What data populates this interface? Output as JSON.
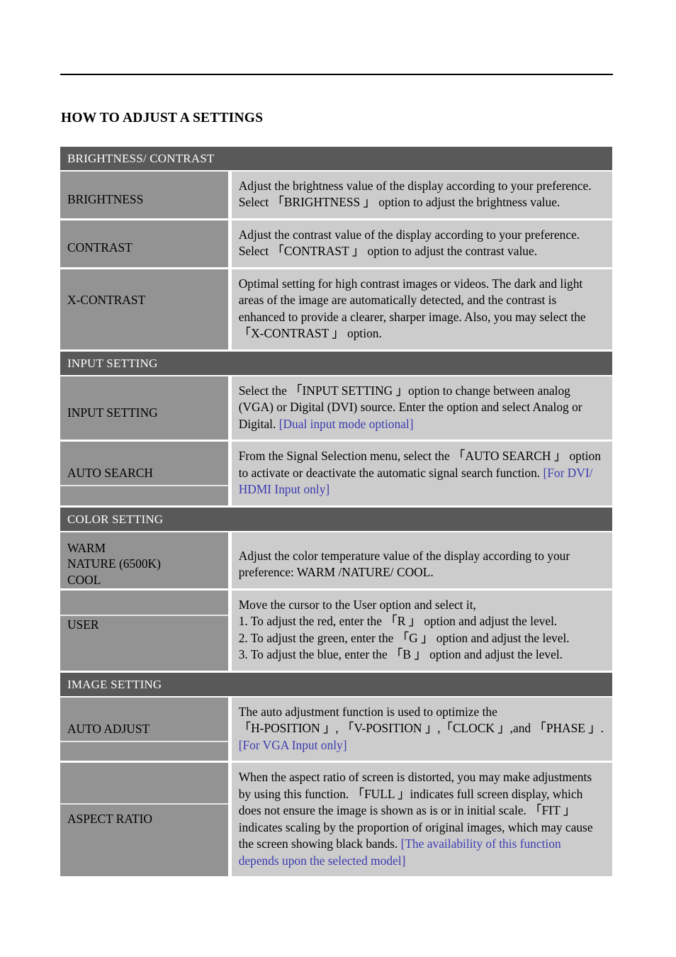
{
  "document": {
    "title": "HOW TO ADJUST A SETTINGS",
    "colors": {
      "section_band": "#595959",
      "label_cell": "#939393",
      "desc_cell": "#cccccc",
      "note_text": "#3b3bb0",
      "rule": "#000000"
    }
  },
  "sections": [
    {
      "header": "BRIGHTNESS/ CONTRAST",
      "rows": [
        {
          "label": "BRIGHTNESS",
          "desc": "Adjust the brightness value of the display according to your preference. Select 「BRIGHTNESS 」 option to adjust the brightness value."
        },
        {
          "label": "CONTRAST",
          "desc": "Adjust the contrast value of the display according to your preference. Select 「CONTRAST 」 option to adjust the contrast value."
        },
        {
          "label": "X-CONTRAST",
          "desc": "Optimal setting for high contrast images or videos. The dark and light areas of the image are automatically detected, and the contrast is enhanced to provide a clearer, sharper image. Also, you may select the 「X-CONTRAST 」 option."
        }
      ]
    },
    {
      "header": "INPUT SETTING",
      "rows": [
        {
          "label": "INPUT SETTING",
          "desc": "Select the 「INPUT SETTING 」option to change between analog (VGA) or Digital (DVI) source. Enter the option and select Analog or Digital. ",
          "note": "[Dual input mode optional]"
        },
        {
          "label": "AUTO SEARCH",
          "desc": "From the Signal Selection menu, select the  「AUTO SEARCH 」 option to activate or deactivate the automatic signal search function. ",
          "note": "[For DVI/ HDMI Input only]"
        }
      ]
    },
    {
      "header": "COLOR SETTING",
      "rows": [
        {
          "label": "WARM\nNATURE (6500K)\nCOOL",
          "desc": "Adjust the color temperature value of the display according to your preference: WARM /NATURE/ COOL."
        },
        {
          "label": "USER",
          "desc_lines": [
            "Move the cursor to the User option and select it,",
            "1. To adjust the red, enter the 「R 」 option and adjust the level.",
            "2. To adjust the green, enter the 「G 」 option and adjust the level.",
            "3. To adjust the blue, enter the 「B 」 option and adjust the level."
          ]
        }
      ]
    },
    {
      "header": "IMAGE SETTING",
      "rows": [
        {
          "label": "AUTO ADJUST",
          "desc_lines": [
            "The auto adjustment function is used to optimize the",
            "「H-POSITION 」, 「V-POSITION 」,「CLOCK 」,and 「PHASE 」."
          ],
          "note": "[For VGA Input only]"
        },
        {
          "label": "ASPECT RATIO",
          "desc": "When the aspect ratio of screen is distorted, you may make adjustments by using this function. 「FULL 」indicates full screen display, which does not ensure the image is shown as is or in initial scale. 「FIT 」indicates scaling by the proportion of original images, which may cause the screen showing black bands. ",
          "note": "[The availability of this function depends upon the selected model]"
        }
      ]
    }
  ]
}
